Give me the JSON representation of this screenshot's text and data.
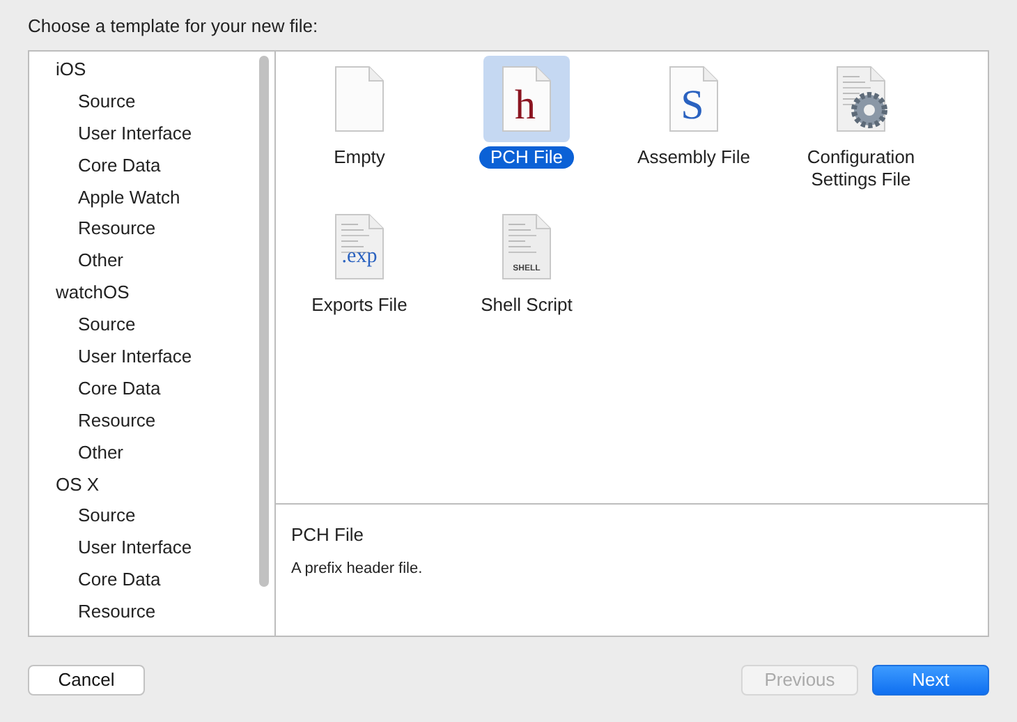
{
  "prompt": "Choose a template for your new file:",
  "sidebar": {
    "items": [
      {
        "label": "iOS",
        "children": [
          {
            "label": "Source"
          },
          {
            "label": "User Interface"
          },
          {
            "label": "Core Data"
          },
          {
            "label": "Apple Watch"
          },
          {
            "label": "Resource"
          },
          {
            "label": "Other"
          }
        ]
      },
      {
        "label": "watchOS",
        "children": [
          {
            "label": "Source"
          },
          {
            "label": "User Interface"
          },
          {
            "label": "Core Data"
          },
          {
            "label": "Resource"
          },
          {
            "label": "Other"
          }
        ]
      },
      {
        "label": "OS X",
        "children": [
          {
            "label": "Source"
          },
          {
            "label": "User Interface"
          },
          {
            "label": "Core Data"
          },
          {
            "label": "Resource"
          }
        ]
      }
    ]
  },
  "templates": [
    {
      "label": "Empty",
      "kind": "blank",
      "selected": false
    },
    {
      "label": "PCH File",
      "kind": "letter",
      "glyph": "h",
      "selected": true
    },
    {
      "label": "Assembly File",
      "kind": "letter",
      "glyph": "S",
      "selected": false
    },
    {
      "label": "Configuration Settings File",
      "kind": "gear",
      "selected": false
    },
    {
      "label": "Exports File",
      "kind": "exp",
      "glyph": ".exp",
      "selected": false
    },
    {
      "label": "Shell Script",
      "kind": "shell",
      "glyph": "SHELL",
      "selected": false
    }
  ],
  "description": {
    "title": "PCH File",
    "text": "A prefix header file."
  },
  "buttons": [
    {
      "label": "Cancel",
      "kind": "plain",
      "disabled": false
    },
    {
      "label": "Previous",
      "kind": "plain",
      "disabled": true
    },
    {
      "label": "Next",
      "kind": "default",
      "disabled": false
    }
  ]
}
